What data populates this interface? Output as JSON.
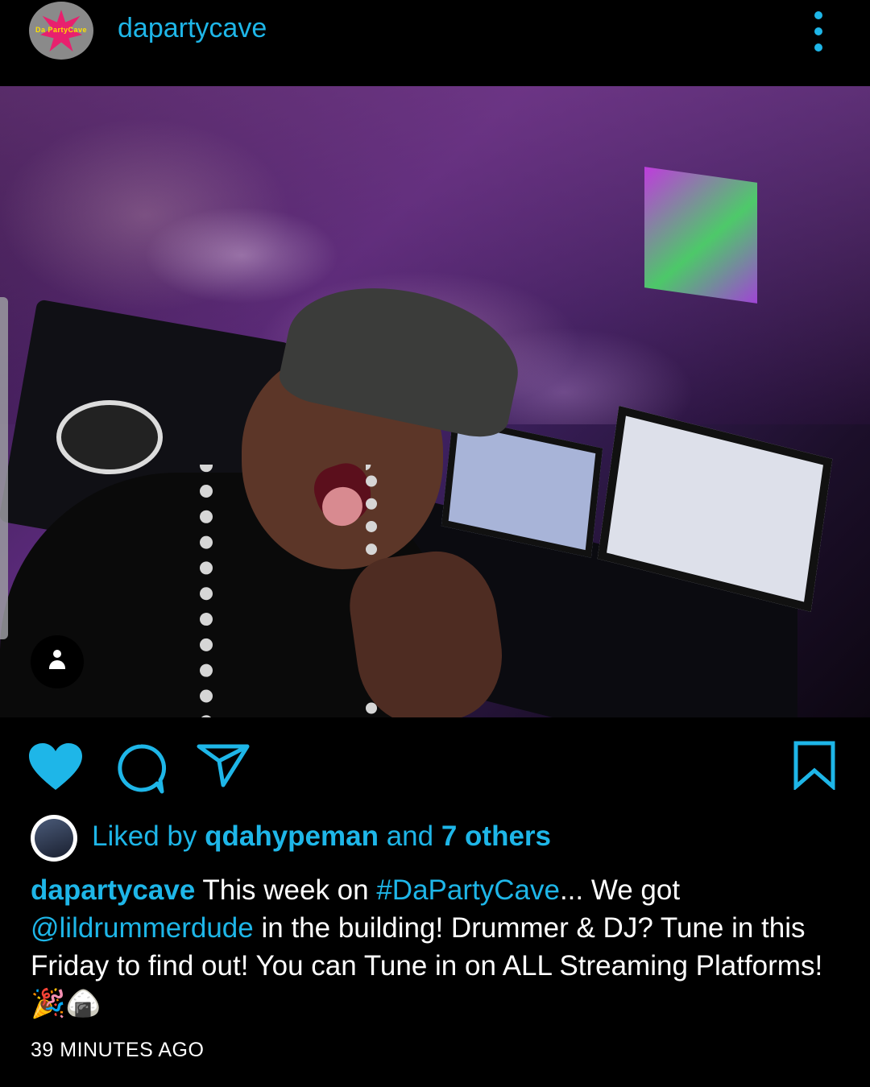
{
  "header": {
    "username": "dapartycave",
    "avatar_text": "Da PartyCave"
  },
  "post": {
    "liked_by_prefix": "Liked by ",
    "liked_by_user": "qdahypeman",
    "liked_by_middle": " and ",
    "liked_by_others": "7 others",
    "caption_user": "dapartycave",
    "caption_part1": " This week on ",
    "caption_hashtag": "#DaPartyCave",
    "caption_part2": "... We got ",
    "caption_mention": "@lildrummerdude",
    "caption_part3": " in the building! Drummer & DJ? Tune in this Friday to find out! You can Tune in on ALL Streaming Platforms! 🎉🍙",
    "timestamp": "39 MINUTES AGO"
  },
  "colors": {
    "accent": "#1eb6e8",
    "background": "#000000",
    "text": "#ffffff"
  },
  "icons": {
    "like": "heart-icon",
    "comment": "comment-icon",
    "share": "send-icon",
    "save": "bookmark-icon",
    "more": "more-vertical-icon",
    "tag": "user-tag-icon"
  }
}
